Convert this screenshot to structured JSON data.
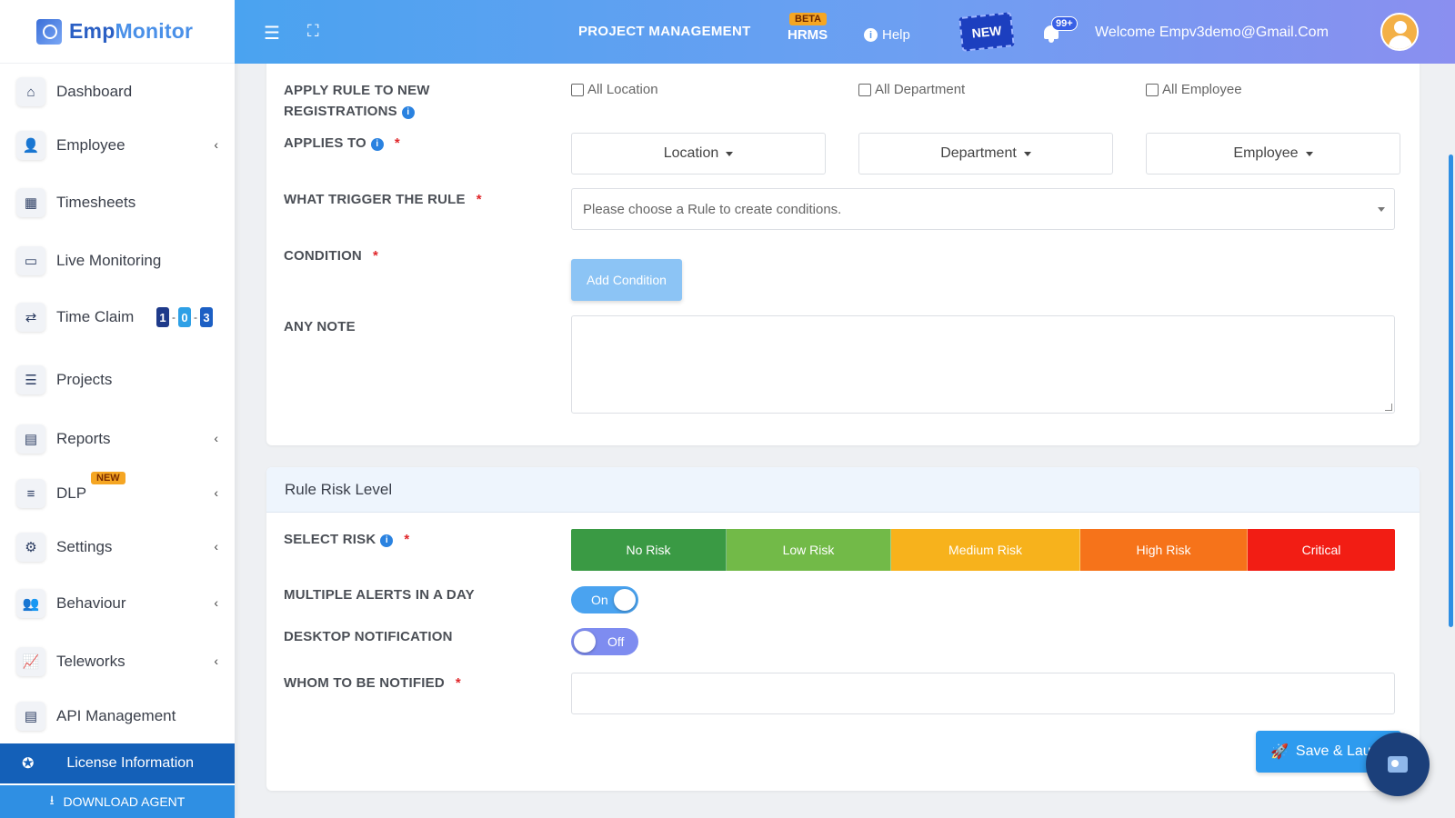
{
  "brand": {
    "name_part1": "Emp",
    "name_part2": "Monitor"
  },
  "sidebar": {
    "items": [
      {
        "label": "Dashboard",
        "icon": "home-icon"
      },
      {
        "label": "Employee",
        "icon": "user-icon"
      },
      {
        "label": "Timesheets",
        "icon": "calendar-icon"
      },
      {
        "label": "Live Monitoring",
        "icon": "monitor-icon"
      },
      {
        "label": "Time Claim",
        "icon": "swap-icon"
      },
      {
        "label": "Projects",
        "icon": "list-icon"
      },
      {
        "label": "Reports",
        "icon": "report-icon"
      },
      {
        "label": "DLP",
        "icon": "sliders-icon",
        "badge": "NEW"
      },
      {
        "label": "Settings",
        "icon": "gear-icon"
      },
      {
        "label": "Behaviour",
        "icon": "user-gear-icon"
      },
      {
        "label": "Teleworks",
        "icon": "chart-icon"
      },
      {
        "label": "API Management",
        "icon": "doc-icon"
      }
    ],
    "time_claim_counts": [
      "1",
      "0",
      "3"
    ],
    "license": "License Information",
    "download": "DOWNLOAD AGENT"
  },
  "header": {
    "project_management": "PROJECT MANAGEMENT",
    "hrms": "HRMS",
    "beta": "BETA",
    "help": "Help",
    "new_badge": "NEW",
    "notification_count": "99+",
    "welcome": "Welcome  Empv3demo@Gmail.Com"
  },
  "rule_form": {
    "apply_new_reg_line1": "APPLY RULE TO NEW",
    "apply_new_reg_line2": "REGISTRATIONS",
    "chk_location": "All Location",
    "chk_department": "All Department",
    "chk_employee": "All Employee",
    "applies_to": "APPLIES TO",
    "dd_location": "Location",
    "dd_department": "Department",
    "dd_employee": "Employee",
    "trigger_label": "WHAT TRIGGER THE RULE",
    "trigger_placeholder": "Please choose a Rule to create conditions.",
    "condition_label": "CONDITION",
    "add_condition": "Add Condition",
    "note_label": "ANY NOTE"
  },
  "risk": {
    "section_title": "Rule Risk Level",
    "select_label": "SELECT RISK",
    "levels": [
      {
        "label": "No Risk",
        "color": "#3a9a44"
      },
      {
        "label": "Low Risk",
        "color": "#72ba48"
      },
      {
        "label": "Medium Risk",
        "color": "#f7b21c"
      },
      {
        "label": "High Risk",
        "color": "#f6731a"
      },
      {
        "label": "Critical",
        "color": "#f21d14"
      }
    ],
    "multiple_alerts_label": "MULTIPLE ALERTS IN A DAY",
    "multiple_alerts_state": "On",
    "desktop_notification_label": "DESKTOP NOTIFICATION",
    "desktop_notification_state": "Off",
    "whom_label": "WHOM TO BE NOTIFIED",
    "save_label": "Save & Laun"
  }
}
